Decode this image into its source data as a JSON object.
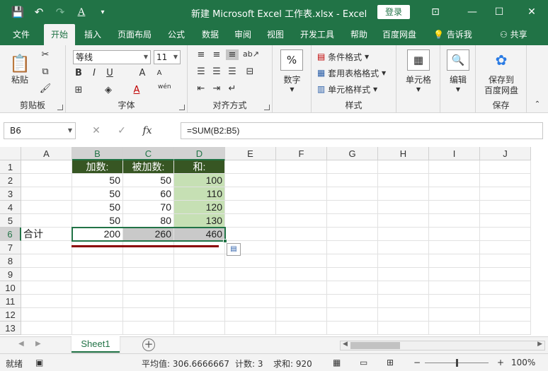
{
  "titlebar": {
    "title": "新建 Microsoft Excel 工作表.xlsx  -  Excel",
    "login_label": "登录",
    "qat_icons": [
      "save-icon",
      "undo-icon",
      "redo-icon",
      "font-color-icon",
      "customize-icon"
    ],
    "qat_glyphs": {
      "save": "💾",
      "undo": "↶",
      "redo": "↷",
      "font": "A",
      "more": "▾"
    },
    "window_glyphs": {
      "options": "⊡",
      "minimize": "—",
      "maximize": "☐",
      "close": "✕"
    }
  },
  "ribbon_tabs": [
    {
      "label": "文件"
    },
    {
      "label": "开始"
    },
    {
      "label": "插入"
    },
    {
      "label": "页面布局"
    },
    {
      "label": "公式"
    },
    {
      "label": "数据"
    },
    {
      "label": "审阅"
    },
    {
      "label": "视图"
    },
    {
      "label": "开发工具"
    },
    {
      "label": "帮助"
    },
    {
      "label": "百度网盘"
    }
  ],
  "active_tab": "开始",
  "tell_me": "告诉我",
  "share": "共享",
  "ribbon": {
    "clipboard": {
      "paste_label": "粘贴",
      "group_label": "剪贴板"
    },
    "font": {
      "font_name": "等线",
      "font_size": "11",
      "group_label": "字体",
      "bold": "B",
      "italic": "I",
      "underline": "U",
      "grow": "A",
      "shrink": "A",
      "phonetic": "wén"
    },
    "alignment": {
      "group_label": "对齐方式"
    },
    "number": {
      "label": "数字",
      "glyph": "%"
    },
    "styles": {
      "conditional": "条件格式",
      "table": "套用表格格式",
      "cell": "单元格样式",
      "group_label": "样式"
    },
    "cells": {
      "label": "单元格"
    },
    "editing": {
      "label": "编辑"
    },
    "save": {
      "label_line1": "保存到",
      "label_line2": "百度网盘",
      "group_label": "保存"
    }
  },
  "formula_bar": {
    "name_box": "B6",
    "formula": "=SUM(B2:B5)",
    "fx": "fx",
    "cancel": "✕",
    "enter": "✓"
  },
  "grid": {
    "columns": [
      "A",
      "B",
      "C",
      "D",
      "E",
      "F",
      "G",
      "H",
      "I",
      "J"
    ],
    "rows": [
      "1",
      "2",
      "3",
      "4",
      "5",
      "6",
      "7",
      "8",
      "9",
      "10",
      "11",
      "12",
      "13"
    ],
    "cells": {
      "B1": "加数:",
      "C1": "被加数:",
      "D1": "和:",
      "B2": "50",
      "C2": "50",
      "D2": "100",
      "B3": "50",
      "C3": "60",
      "D3": "110",
      "B4": "50",
      "C4": "70",
      "D4": "120",
      "B5": "50",
      "C5": "80",
      "D5": "130",
      "A6": "合计",
      "B6": "200",
      "C6": "260",
      "D6": "460"
    },
    "colors": {
      "header_fill": "#375623",
      "sum_fill": "#c6e0b4",
      "total_fill": "#c9c9c9",
      "accent": "#217346",
      "marker": "#8b0000"
    }
  },
  "sheets": {
    "tabs": [
      "Sheet1"
    ],
    "add_glyph": "+"
  },
  "statusbar": {
    "ready": "就绪",
    "average": "平均值: 306.6666667",
    "count": "计数: 3",
    "sum": "求和: 920",
    "zoom": "100%"
  }
}
